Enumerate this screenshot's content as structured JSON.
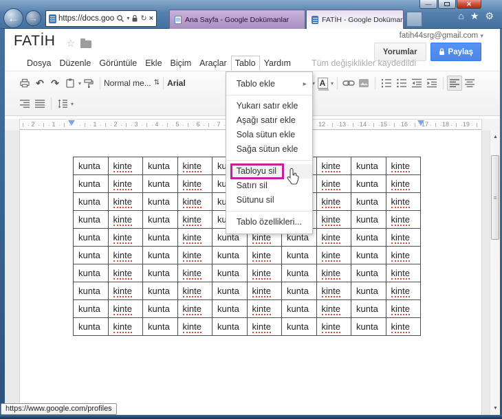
{
  "chrome": {
    "url_text": "https://docs.goo...",
    "back_icon": "←",
    "forward_icon": "→",
    "search_dropdown_icon": "▾",
    "refresh_icon": "↻",
    "stop_icon": "×",
    "home_icon": "⌂",
    "favorite_icon": "★",
    "tools_icon": "⚙",
    "minimize_icon": "—",
    "close_icon": "✕",
    "tabs": [
      {
        "label": "Ana Sayfa - Google Dokümanlar",
        "active": false
      },
      {
        "label": "FATİH - Google Dokümanlar",
        "active": true,
        "close_icon": "✕"
      }
    ],
    "status_tooltip": "https://www.google.com/profiles"
  },
  "header": {
    "doc_title": "FATİH",
    "star_icon": "☆",
    "account_email": "fatih44srg@gmail.com",
    "account_arrow": "▾",
    "comments_button": "Yorumlar",
    "share_button": "Paylaş"
  },
  "menubar": {
    "items": [
      "Dosya",
      "Düzenle",
      "Görüntüle",
      "Ekle",
      "Biçim",
      "Araçlar",
      "Tablo",
      "Yardım"
    ],
    "open_menu": "Tablo",
    "save_status": "Tüm değişiklikler kaydedildi"
  },
  "toolbar": {
    "style_selector": "Normal me...",
    "style_stepper_icon": "⇅",
    "font_selector": "Arial",
    "undo_icon": "↶",
    "redo_icon": "↷",
    "text_color_label": "A",
    "highlight_label": "A",
    "dropdown_arrow": "▾"
  },
  "table_menu": {
    "items": [
      {
        "label": "Tablo ekle",
        "submenu": true
      },
      {
        "label": "Yukarı satır ekle"
      },
      {
        "label": "Aşağı satır ekle"
      },
      {
        "label": "Sola sütun ekle"
      },
      {
        "label": "Sağa sütun ekle"
      },
      {
        "label": "Tabloyu sil",
        "highlighted": true
      },
      {
        "label": "Satırı sil"
      },
      {
        "label": "Sütunu sil"
      },
      {
        "label": "Tablo özellikleri..."
      }
    ],
    "separators_after": [
      0,
      4,
      7
    ],
    "submenu_arrow_icon": "▸",
    "annotation_color": "#c2209c"
  },
  "ruler": {
    "margin_labels": [
      "2",
      "1"
    ],
    "content_label_start": 1,
    "content_label_end": 19,
    "indent_marker_color": "#7ba7e8"
  },
  "document_table": {
    "rows": 10,
    "cols": 10,
    "odd_column_word": "kunta",
    "even_column_word": "kinte",
    "misspelled_word": "kinte",
    "spellcheck_color": "#e8442c"
  },
  "scrollbar": {
    "up_icon": "▲",
    "down_icon": "▼",
    "grip_icon": "≡"
  }
}
